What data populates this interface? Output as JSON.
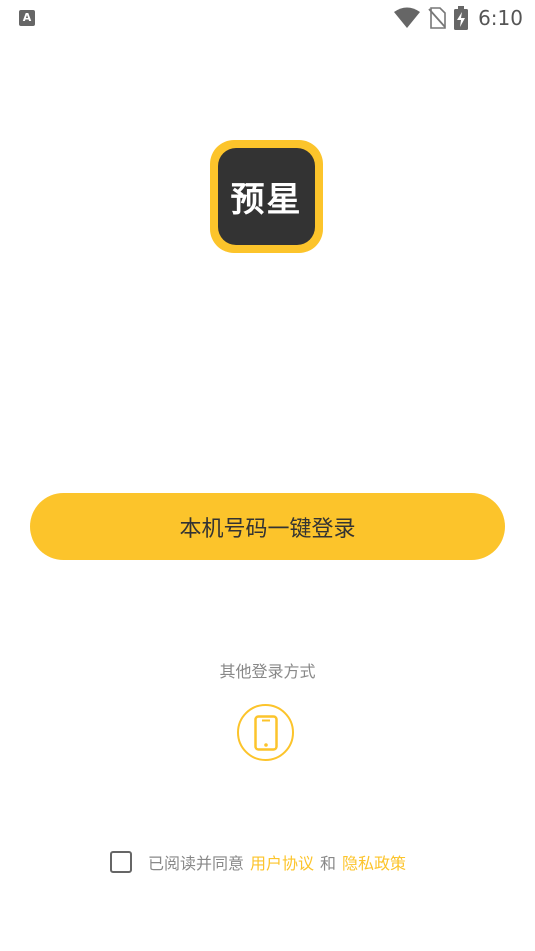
{
  "status_bar": {
    "left_icon_letter": "A",
    "time": "6:10",
    "icons": [
      "wifi-icon",
      "no-sim-icon",
      "battery-charging-icon"
    ]
  },
  "logo": {
    "text": "预星",
    "bg_color": "#fcc42b",
    "inner_color": "#333333"
  },
  "login": {
    "one_click_label": "本机号码一键登录"
  },
  "other_methods": {
    "label": "其他登录方式",
    "phone_icon": "smartphone-icon"
  },
  "agreement": {
    "prefix": "已阅读并同意",
    "user_agreement": "用户协议",
    "and": "和",
    "privacy_policy": "隐私政策"
  },
  "colors": {
    "accent": "#fcc42b",
    "text_dark": "#333333",
    "text_gray": "#888888"
  }
}
